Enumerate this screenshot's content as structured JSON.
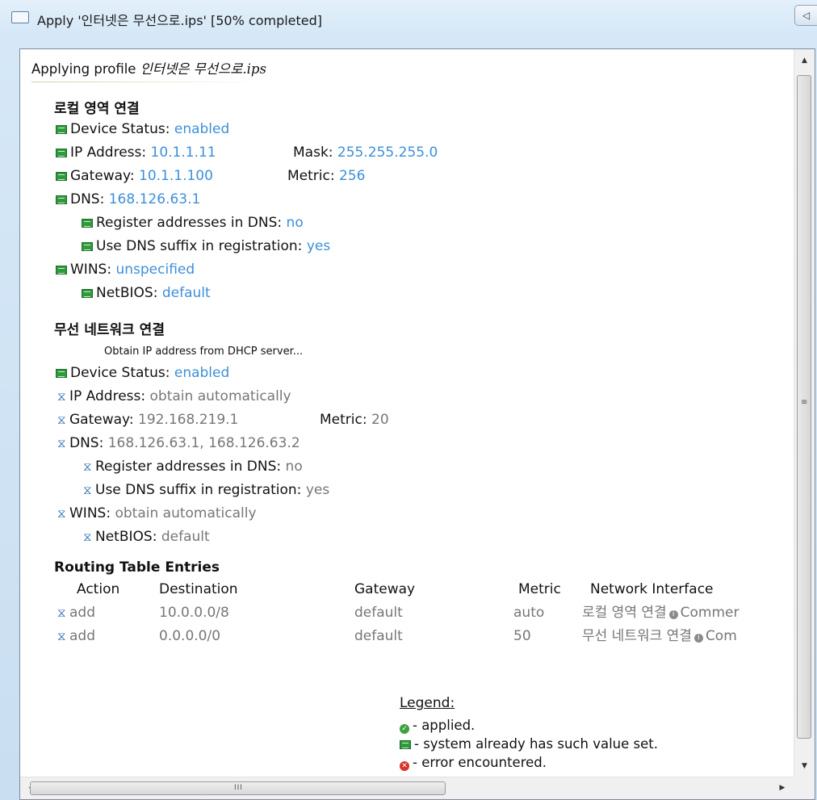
{
  "window": {
    "title": "Apply '인터넷은 무선으로.ips' [50% completed]",
    "corner_button": "◁"
  },
  "header": {
    "prefix": "Applying profile",
    "profile": "인터넷은 무선으로.ips"
  },
  "local": {
    "title": "로컬 영역 연결",
    "device_label": "Device Status:",
    "device_value": "enabled",
    "ip_label": "IP Address:",
    "ip_value": "10.1.1.11",
    "mask_label": "Mask:",
    "mask_value": "255.255.255.0",
    "gw_label": "Gateway:",
    "gw_value": "10.1.1.100",
    "metric_label": "Metric:",
    "metric_value": "256",
    "dns_label": "DNS:",
    "dns_value": "168.126.63.1",
    "reg_label": "Register addresses in DNS:",
    "reg_value": "no",
    "suffix_label": "Use DNS suffix in registration:",
    "suffix_value": "yes",
    "wins_label": "WINS:",
    "wins_value": "unspecified",
    "netbios_label": "NetBIOS:",
    "netbios_value": "default"
  },
  "wireless": {
    "title": "무선 네트워크 연결",
    "note": "Obtain IP address from DHCP server...",
    "device_label": "Device Status:",
    "device_value": "enabled",
    "ip_label": "IP Address:",
    "ip_value": "obtain automatically",
    "gw_label": "Gateway:",
    "gw_value": "192.168.219.1",
    "metric_label": "Metric:",
    "metric_value": "20",
    "dns_label": "DNS:",
    "dns_value": "168.126.63.1, 168.126.63.2",
    "reg_label": "Register addresses in DNS:",
    "reg_value": "no",
    "suffix_label": "Use DNS suffix in registration:",
    "suffix_value": "yes",
    "wins_label": "WINS:",
    "wins_value": "obtain automatically",
    "netbios_label": "NetBIOS:",
    "netbios_value": "default"
  },
  "routing": {
    "title": "Routing Table Entries",
    "headers": {
      "action": "Action",
      "destination": "Destination",
      "gateway": "Gateway",
      "metric": "Metric",
      "interface": "Network Interface"
    },
    "rows": [
      {
        "action": "add",
        "destination": "10.0.0.0/8",
        "gateway": "default",
        "metric": "auto",
        "interface": "로컬 영역 연결",
        "comment": "Commer"
      },
      {
        "action": "add",
        "destination": "0.0.0.0/0",
        "gateway": "default",
        "metric": "50",
        "interface": "무선 네트워크 연결",
        "comment": "Com"
      }
    ]
  },
  "legend": {
    "title": "Legend:",
    "applied": "- applied.",
    "already": "- system already has such value set.",
    "error": "- error encountered."
  },
  "icons": {
    "ok": "ok-badge-icon",
    "pending": "hourglass-icon",
    "applied": "check-circle-icon",
    "error": "error-circle-icon",
    "info": "info-icon"
  },
  "colors": {
    "value_blue": "#3d8fd9",
    "value_gray": "#767676",
    "ok_green": "#2f9a3c",
    "error_red": "#d9342b"
  }
}
